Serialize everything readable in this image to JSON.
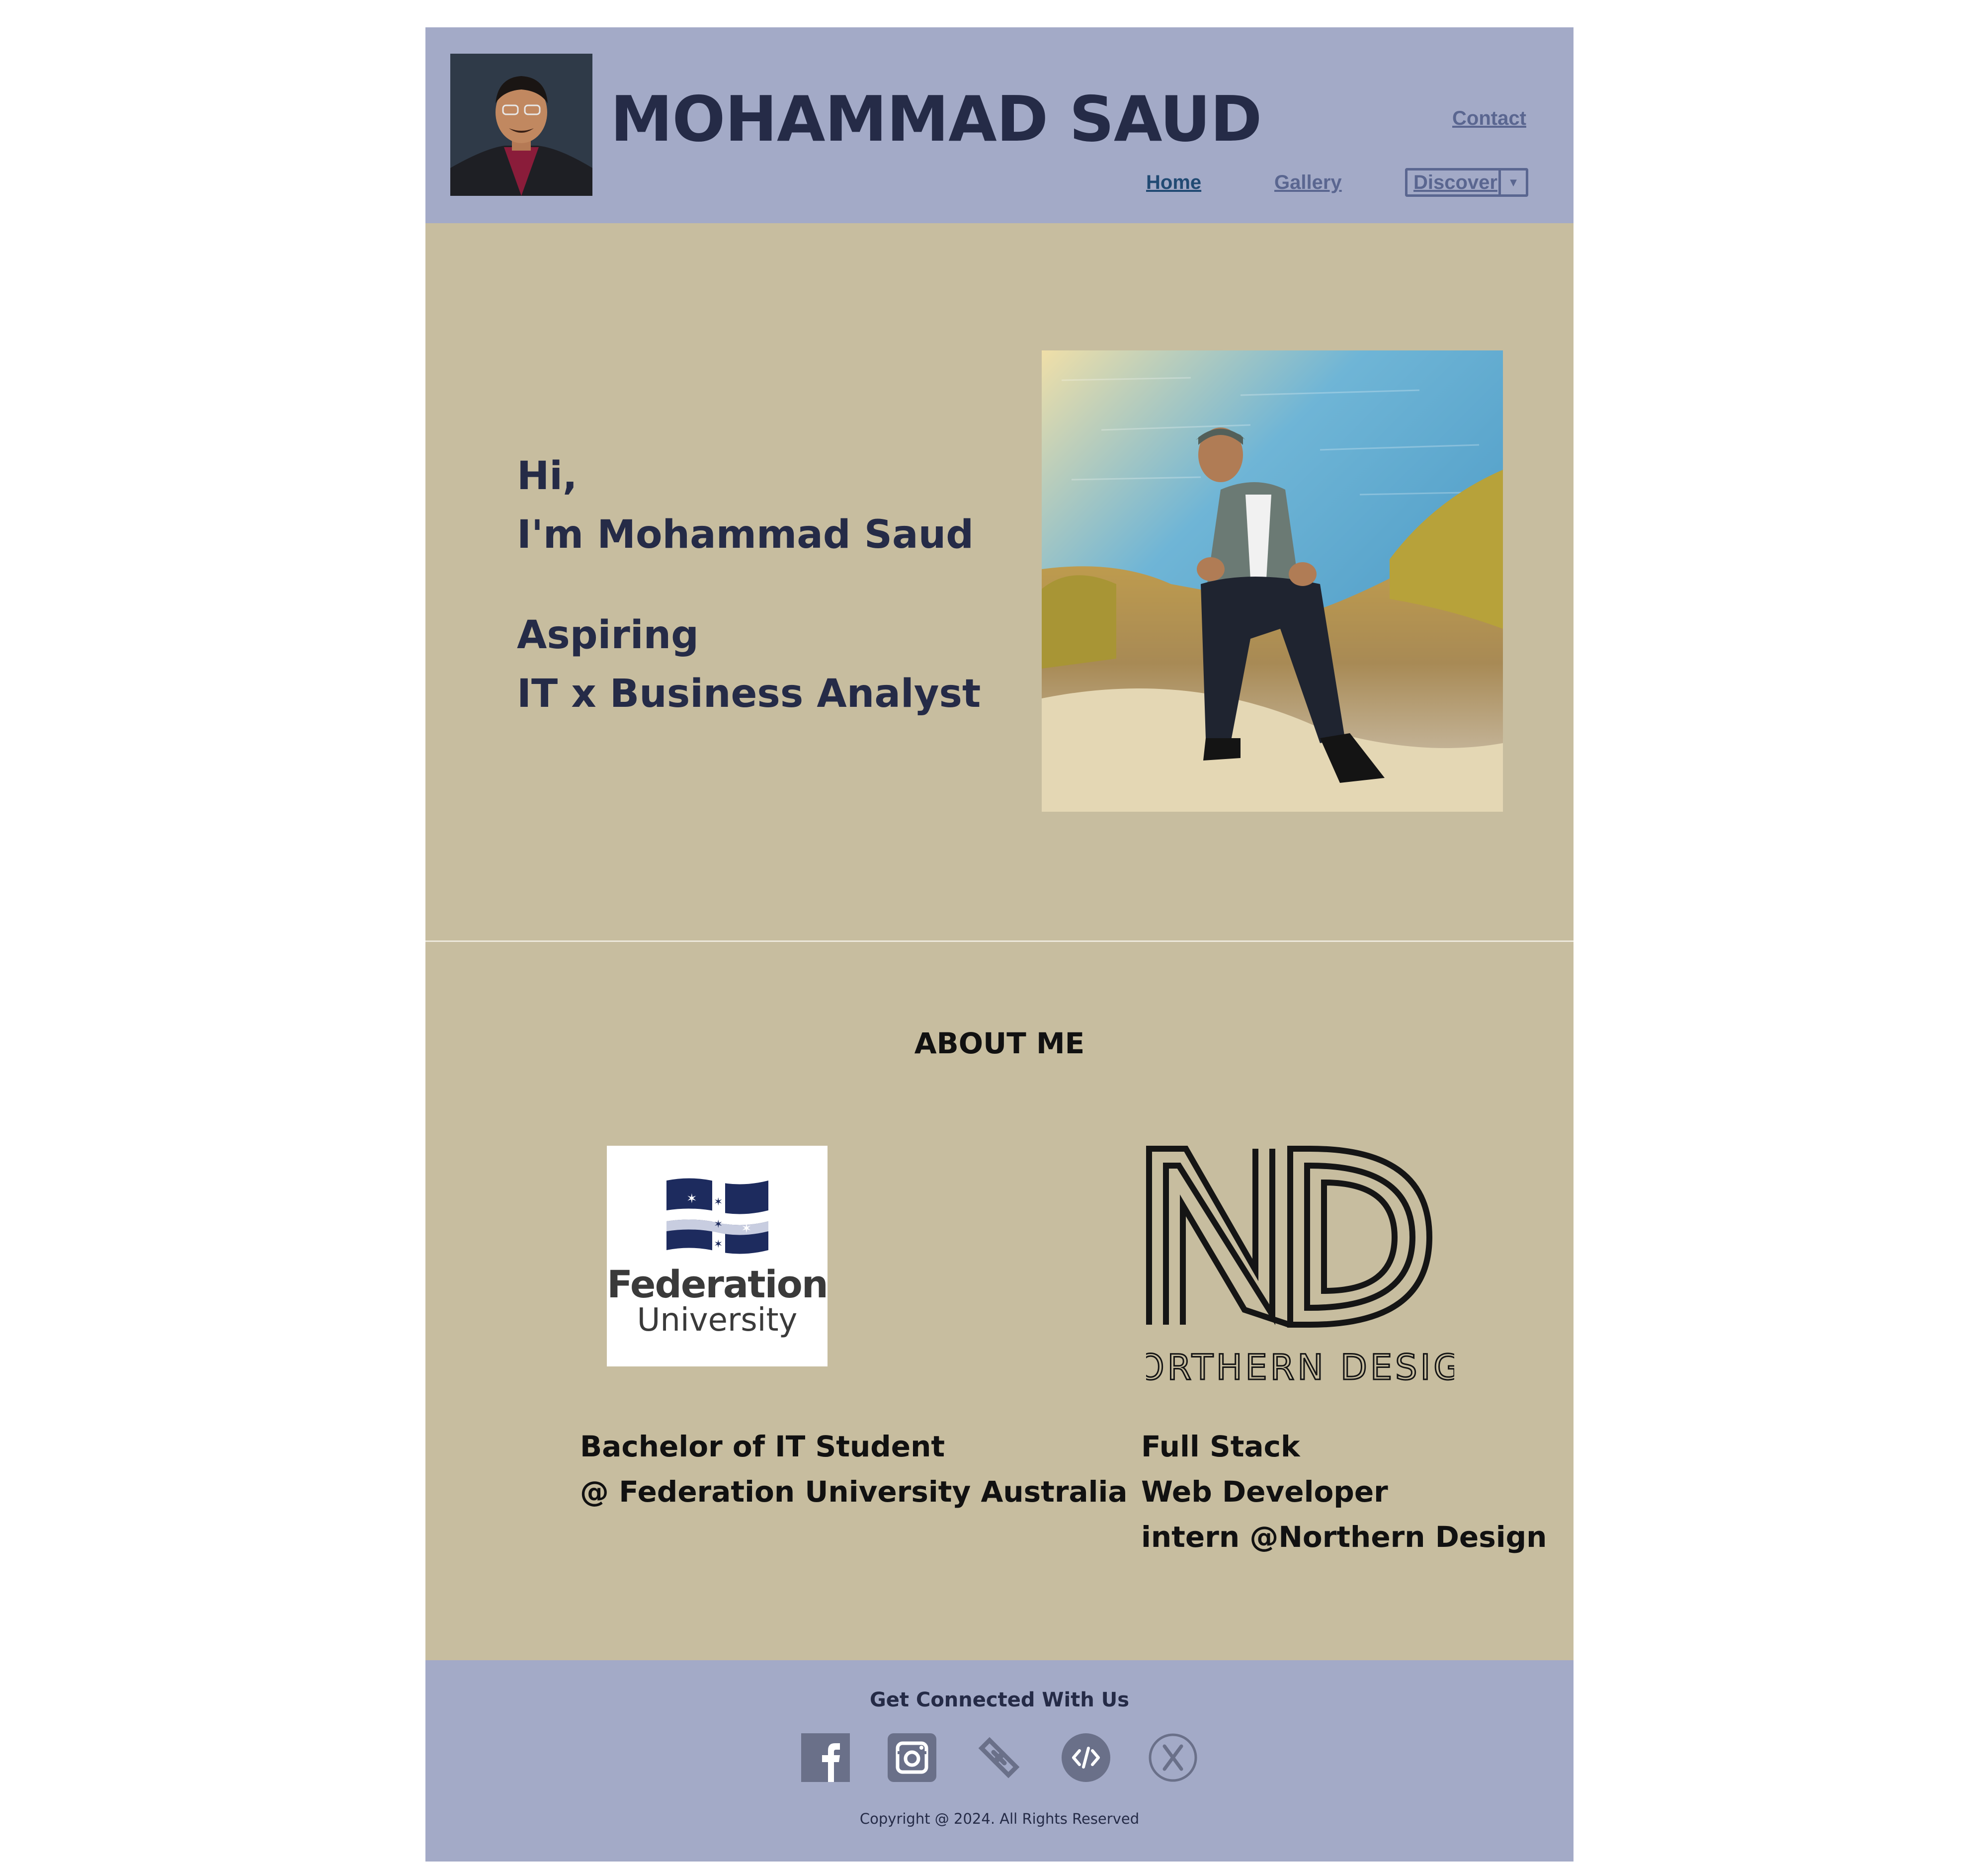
{
  "header": {
    "title": "MOHAMMAD SAUD",
    "nav": {
      "contact": "Contact",
      "home": "Home",
      "gallery": "Gallery",
      "discover": "Discover"
    }
  },
  "hero": {
    "greeting_line1": "Hi,",
    "greeting_line2": "I'm Mohammad Saud",
    "role_line1": "Aspiring",
    "role_line2": "IT x Business Analyst"
  },
  "about": {
    "heading": "ABOUT ME",
    "education_logo_text": [
      "Federation",
      "University"
    ],
    "education_line1": "Bachelor of IT Student",
    "education_line2": "@ Federation University Australia",
    "work_logo_text": "NORTHERN DESIGN",
    "work_line1": "Full Stack",
    "work_line2": "Web Developer",
    "work_line3": "intern @Northern Design"
  },
  "footer": {
    "title": "Get Connected With Us",
    "socials": [
      "facebook-icon",
      "instagram-icon",
      "link-icon",
      "code-icon",
      "x-icon"
    ],
    "copyright": "Copyright @ 2024. All Rights Reserved"
  },
  "colors": {
    "header_bg": "#a3aac7",
    "content_bg": "#c7bd9f",
    "title_text": "#252b47",
    "nav_link": "#5a6690",
    "nav_active": "#214a73"
  }
}
